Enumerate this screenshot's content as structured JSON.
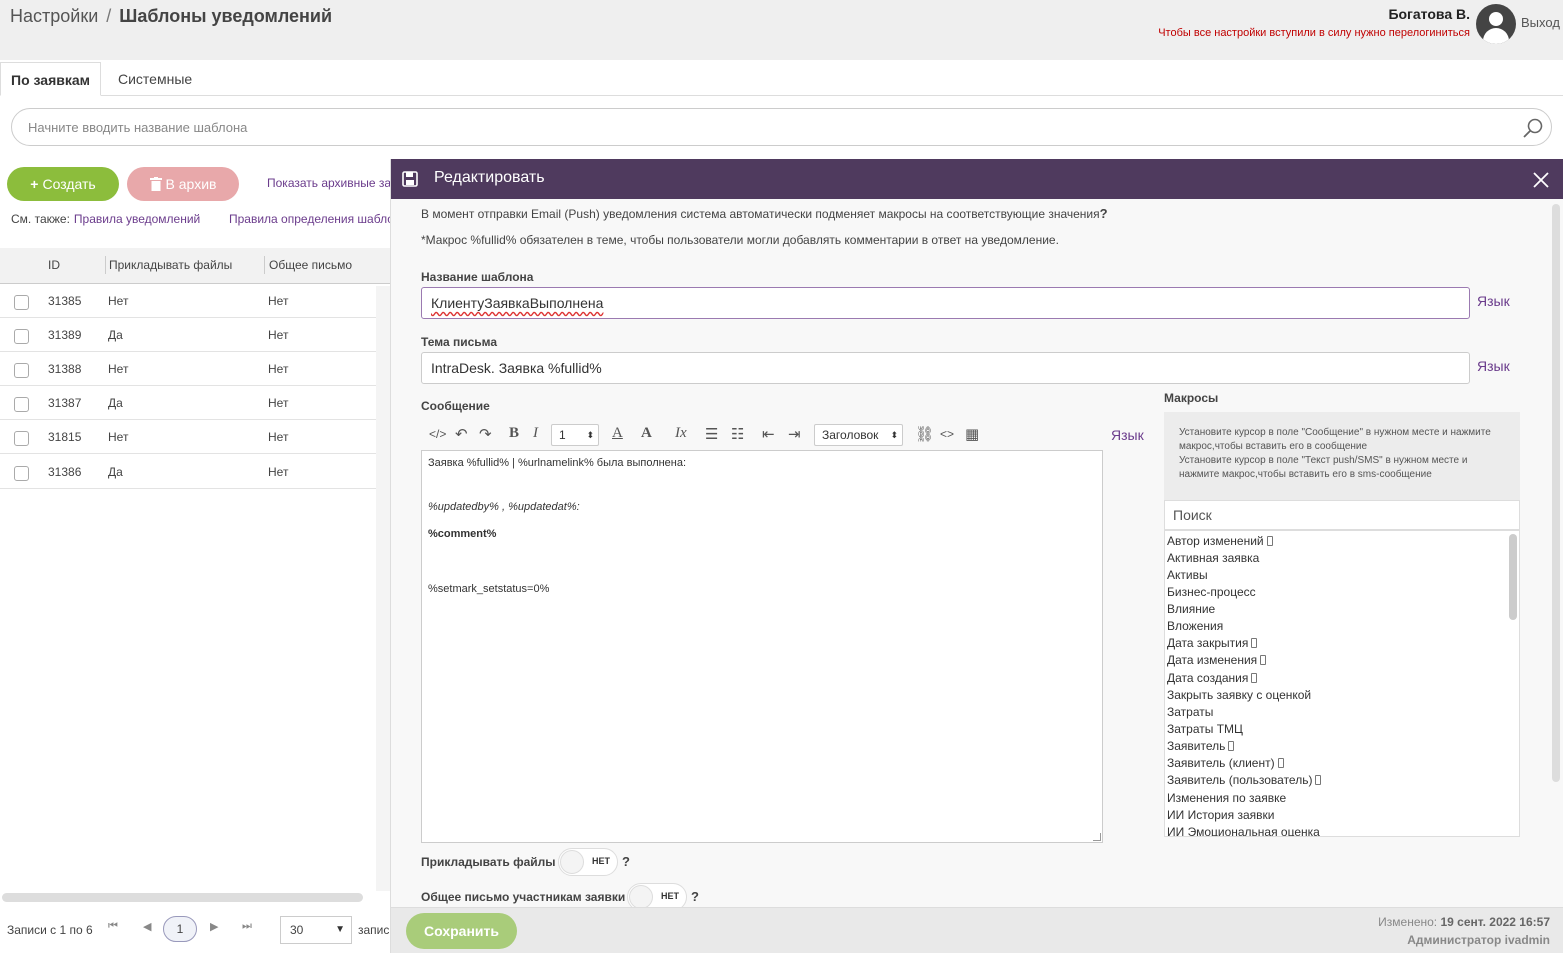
{
  "header": {
    "breadcrumb_root": "Настройки",
    "breadcrumb_sep": "/",
    "page_title": "Шаблоны уведомлений",
    "user_name": "Богатова В.",
    "relogin_note": "Чтобы все настройки вступили в силу нужно перелогиниться",
    "logout_label": "Выход"
  },
  "tabs": [
    {
      "label": "По заявкам",
      "active": true
    },
    {
      "label": "Системные",
      "active": false
    }
  ],
  "search": {
    "placeholder": "Начните вводить название шаблона",
    "value": ""
  },
  "actions": {
    "create_label": "Создать",
    "archive_label": "В архив",
    "show_archive_label": "Показать архивные за"
  },
  "see_also": {
    "prefix": "См. также:",
    "link1": "Правила уведомлений",
    "link2": "Правила определения шабло"
  },
  "table": {
    "columns": [
      "ID",
      "Прикладывать файлы",
      "Общее письмо"
    ],
    "rows": [
      [
        "31385",
        "Нет",
        "Нет"
      ],
      [
        "31389",
        "Да",
        "Нет"
      ],
      [
        "31388",
        "Нет",
        "Нет"
      ],
      [
        "31387",
        "Да",
        "Нет"
      ],
      [
        "31815",
        "Нет",
        "Нет"
      ],
      [
        "31386",
        "Да",
        "Нет"
      ]
    ]
  },
  "pager": {
    "summary": "Записи с 1 по 6",
    "first": "⏮",
    "prev": "◀",
    "next": "▶",
    "last": "⏭",
    "current_page": "1",
    "per_page": "30",
    "records_word": "запис"
  },
  "modal": {
    "title": "Редактировать",
    "info_macros": "В момент отправки Email (Push) уведомления система автоматически подменяет макросы на соответствующие значения",
    "info_q": "?",
    "info_fullid": "*Макрос %fullid% обязателен в теме, чтобы пользователи могли добавлять комментарии в ответ на уведомление.",
    "name_label": "Название шаблона",
    "name_value": "КлиентуЗаявкаВыполнена",
    "subject_label": "Тема письма",
    "subject_value": "IntraDesk. Заявка %fullid%",
    "lang_label": "Язык",
    "message_label": "Сообщение",
    "toolbar": {
      "font_size": "1",
      "heading": "Заголовок"
    },
    "message_lines": {
      "l1": "Заявка %fullid% | %urlnamelink% была выполнена:",
      "l2": "%updatedby% , %updatedat%:",
      "l3": "%comment%",
      "l4": "%setmark_setstatus=0%"
    },
    "macros": {
      "title": "Макросы",
      "hint1": "Установите курсор в поле \"Сообщение\" в нужном месте и нажмите макрос,чтобы вставить его в сообщение",
      "hint2": "Установите курсор в поле \"Текст push/SMS\" в нужном месте и нажмите макрос,чтобы вставить его в sms-сообщение",
      "search_placeholder": "Поиск",
      "items": [
        {
          "label": "Автор изменений",
          "mobile": true
        },
        {
          "label": "Активная заявка",
          "mobile": false
        },
        {
          "label": "Активы",
          "mobile": false
        },
        {
          "label": "Бизнес-процесс",
          "mobile": false
        },
        {
          "label": "Влияние",
          "mobile": false
        },
        {
          "label": "Вложения",
          "mobile": false
        },
        {
          "label": "Дата закрытия",
          "mobile": true
        },
        {
          "label": "Дата изменения",
          "mobile": true
        },
        {
          "label": "Дата создания",
          "mobile": true
        },
        {
          "label": "Закрыть заявку с оценкой",
          "mobile": false
        },
        {
          "label": "Затраты",
          "mobile": false
        },
        {
          "label": "Затраты ТМЦ",
          "mobile": false
        },
        {
          "label": "Заявитель",
          "mobile": true
        },
        {
          "label": "Заявитель (клиент)",
          "mobile": true
        },
        {
          "label": "Заявитель (пользователь)",
          "mobile": true
        },
        {
          "label": "Изменения по заявке",
          "mobile": false
        },
        {
          "label": "ИИ История заявки",
          "mobile": false
        },
        {
          "label": "ИИ Эмоциональная оценка",
          "mobile": false
        }
      ]
    },
    "attach_files_label": "Прикладывать файлы",
    "common_letter_label": "Общее письмо участникам заявки",
    "toggle_off": "НЕТ",
    "q": "?",
    "save_label": "Сохранить",
    "changed_prefix": "Изменено:",
    "changed_date": "19 сент. 2022 16:57",
    "changed_by": "Администратор ivadmin"
  }
}
